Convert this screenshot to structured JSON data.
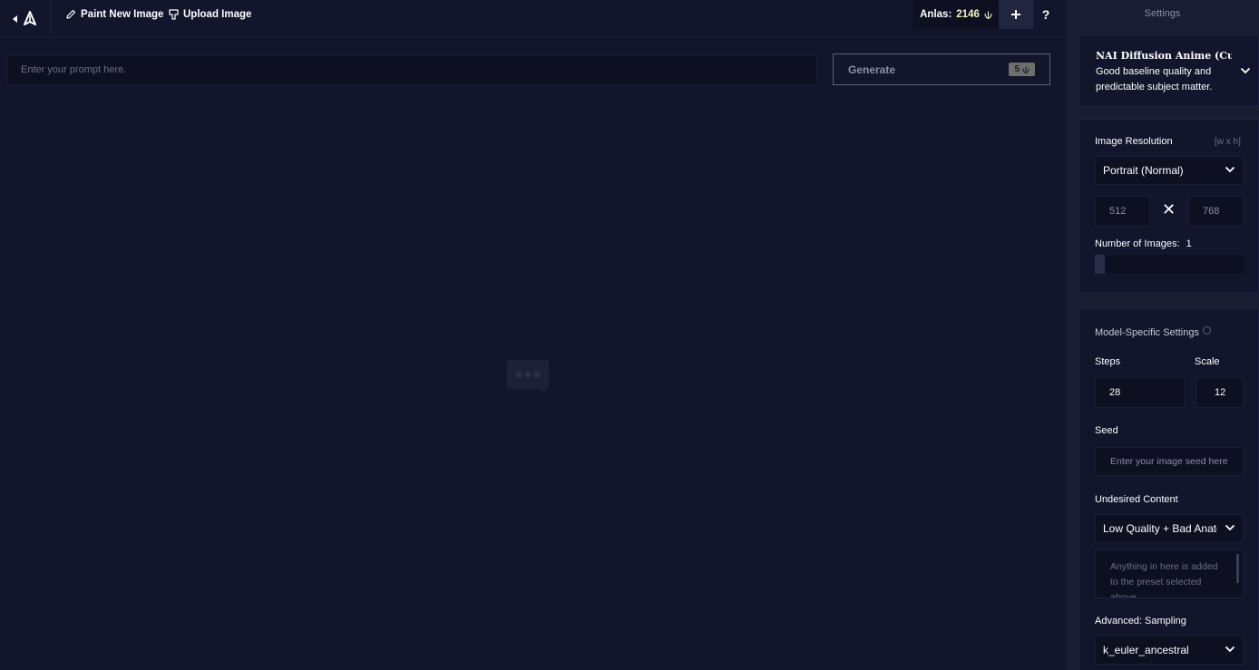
{
  "topbar": {
    "paint_new_image": "Paint New Image",
    "upload_image": "Upload Image",
    "anlas_label": "Anlas:",
    "anlas_value": "2146",
    "help_label": "?"
  },
  "prompt": {
    "placeholder": "Enter your prompt here.",
    "value": ""
  },
  "generate": {
    "label": "Generate",
    "cost": "5"
  },
  "settings": {
    "title": "Settings",
    "model": {
      "name": "NAI Diffusion Anime (Curated)",
      "description": "Good baseline quality and predictable subject matter."
    },
    "resolution": {
      "label": "Image Resolution",
      "hint": "[w x h]",
      "preset": "Portrait (Normal)",
      "width": "512",
      "height": "768",
      "times_symbol": "✕"
    },
    "number_of_images": {
      "label": "Number of Images:",
      "value": "1"
    },
    "model_specific": {
      "label": "Model-Specific Settings",
      "steps_label": "Steps",
      "steps_value": "28",
      "scale_label": "Scale",
      "scale_value": "12",
      "seed_label": "Seed",
      "seed_placeholder": "Enter your image seed here.",
      "undesired_label": "Undesired Content",
      "undesired_preset": "Low Quality + Bad Anatomy",
      "undesired_placeholder": "Anything in here is added to the preset selected above.",
      "sampling_label": "Advanced: Sampling",
      "sampling_value": "k_euler_ancestral"
    }
  },
  "colors": {
    "background": "#13152c",
    "sidebar": "#1a1c32",
    "accent_text": "#f5f3c2",
    "muted_text": "#8d8fa6"
  }
}
